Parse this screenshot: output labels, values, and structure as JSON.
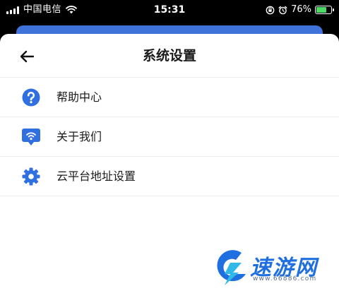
{
  "status_bar": {
    "carrier": "中国电信",
    "time": "15:31",
    "battery_percent": "76%",
    "battery_level": 0.76
  },
  "page": {
    "title": "系统设置"
  },
  "menu": [
    {
      "label": "帮助中心",
      "icon": "help-circle-icon"
    },
    {
      "label": "关于我们",
      "icon": "about-us-icon"
    },
    {
      "label": "云平台地址设置",
      "icon": "gear-icon"
    }
  ],
  "watermark": {
    "brand": "速游网",
    "url": "www.66886.com"
  },
  "colors": {
    "accent": "#3f73d9",
    "icon_blue": "#2f6fe0",
    "watermark_blue": "#1f6fe0"
  }
}
